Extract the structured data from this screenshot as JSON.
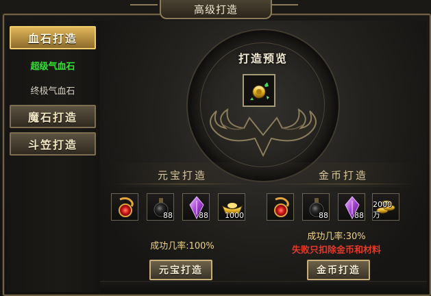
{
  "window": {
    "title": "高级打造"
  },
  "sidebar": {
    "tabs": [
      {
        "label": "血石打造",
        "active": true
      },
      {
        "label": "魔石打造",
        "active": false
      },
      {
        "label": "斗笠打造",
        "active": false
      }
    ],
    "subitems": [
      {
        "label": "超级气血石",
        "selected": true,
        "color": "#33e233"
      },
      {
        "label": "终极气血石",
        "selected": false,
        "color": "#d6d0c2"
      }
    ]
  },
  "preview": {
    "label": "打造预览",
    "icon": "golden-pendant-icon"
  },
  "yuanbao": {
    "header": "元宝打造",
    "materials": [
      {
        "icon": "red-dragon-gem-icon",
        "count": ""
      },
      {
        "icon": "black-potion-bottle-icon",
        "count": "88"
      },
      {
        "icon": "purple-crystal-icon",
        "count": "88"
      },
      {
        "icon": "gold-ingot-icon",
        "count": "1000"
      }
    ],
    "rate": "成功几率:100%",
    "button": "元宝打造"
  },
  "gold": {
    "header": "金币打造",
    "materials": [
      {
        "icon": "red-dragon-gem-icon",
        "count": ""
      },
      {
        "icon": "black-potion-bottle-icon",
        "count": "88"
      },
      {
        "icon": "purple-crystal-icon",
        "count": "88"
      },
      {
        "icon": "gold-coins-icon",
        "count": "2000万"
      }
    ],
    "rate": "成功几率:30%",
    "warning": "失败只扣除金币和材料",
    "button": "金币打造"
  },
  "colors": {
    "accent_gold": "#e0b65a",
    "rate_text": "#efd487",
    "warning_text": "#e23a2a",
    "selected_green": "#33e233"
  }
}
